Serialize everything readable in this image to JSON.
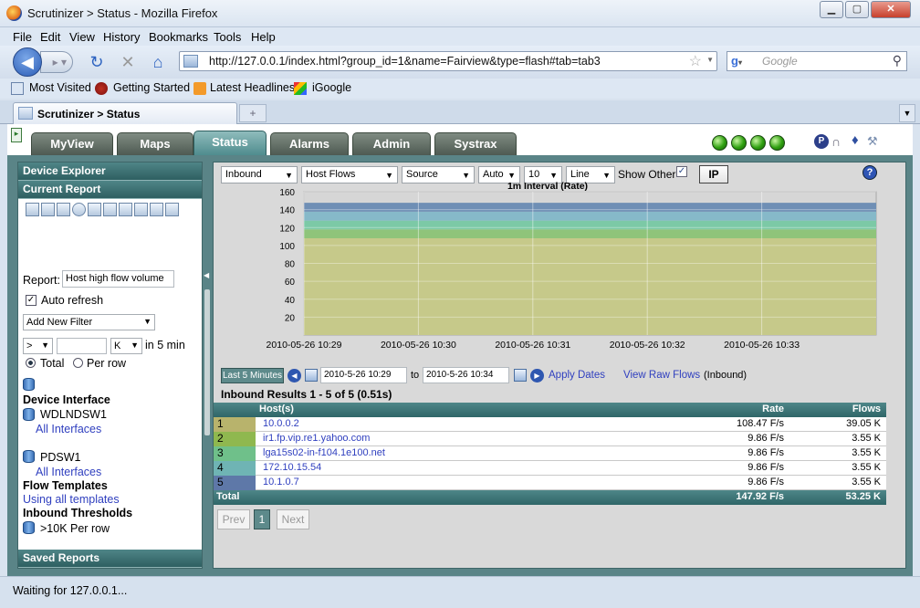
{
  "window": {
    "title": "Scrutinizer > Status - Mozilla Firefox"
  },
  "menubar": [
    "File",
    "Edit",
    "View",
    "History",
    "Bookmarks",
    "Tools",
    "Help"
  ],
  "navbar": {
    "url": "http://127.0.0.1/index.html?group_id=1&name=Fairview&type=flash#tab=tab3",
    "search_placeholder": "Google"
  },
  "bookmarks": [
    "Most Visited",
    "Getting Started",
    "Latest Headlines",
    "iGoogle"
  ],
  "browser_tab": {
    "title": "Scrutinizer > Status"
  },
  "app_tabs": [
    "MyView",
    "Maps",
    "Status",
    "Alarms",
    "Admin",
    "Systrax"
  ],
  "left": {
    "device_explorer": "Device Explorer",
    "current_report": "Current Report",
    "report_label": "Report:",
    "report_value": "Host high flow volume",
    "auto_refresh": "Auto refresh",
    "add_filter": "Add New Filter",
    "op": ">",
    "unit": "K",
    "in_min": "in 5 min",
    "total": "Total",
    "per_row": "Per row",
    "device_interface_h": "Device Interface",
    "dev1": "WDLNDSW1",
    "dev1_link": "All Interfaces",
    "dev2": "PDSW1",
    "dev2_link": "All Interfaces",
    "flow_templates_h": "Flow Templates",
    "flow_templates_link": "Using all templates",
    "thresholds_h": "Inbound Thresholds",
    "threshold_val": ">10K Per row",
    "saved_reports": "Saved Reports"
  },
  "controls": {
    "direction": "Inbound",
    "report_type": "Host Flows",
    "field": "Source",
    "scale": "Auto",
    "count": "10",
    "graph": "Line",
    "show_other": "Show Other",
    "ip": "IP",
    "help": "?"
  },
  "chart_data": {
    "type": "area",
    "title": "1m Interval (Rate)",
    "x": [
      "2010-05-26 10:29",
      "2010-05-26 10:30",
      "2010-05-26 10:31",
      "2010-05-26 10:32",
      "2010-05-26 10:33"
    ],
    "ylim": [
      0,
      160
    ],
    "yticks": [
      20,
      40,
      60,
      80,
      100,
      120,
      140,
      160
    ],
    "series": [
      {
        "values": [
          108,
          108,
          108,
          108,
          108,
          108
        ],
        "color": "#c6c98a"
      },
      {
        "values": [
          9.9,
          9.9,
          9.9,
          9.9,
          9.9,
          9.9
        ],
        "color": "#8fc47a"
      },
      {
        "values": [
          9.9,
          9.9,
          9.9,
          9.9,
          9.9,
          9.9
        ],
        "color": "#7cc9a6"
      },
      {
        "values": [
          9.9,
          9.9,
          9.9,
          9.9,
          9.9,
          9.9
        ],
        "color": "#86b9c9"
      },
      {
        "values": [
          9.9,
          9.9,
          9.9,
          9.9,
          9.9,
          9.9
        ],
        "color": "#6f8fb5"
      }
    ],
    "grid": true
  },
  "timebar": {
    "last_btn": "Last 5 Minutes",
    "from": "2010-5-26 10:29",
    "to_label": "to",
    "to": "2010-5-26 10:34",
    "apply": "Apply Dates",
    "raw": "View Raw Flows",
    "raw_suffix": "(Inbound)"
  },
  "results": {
    "summary": "Inbound Results 1 - 5 of 5 (0.51s)",
    "headers": {
      "host": "Host(s)",
      "rate": "Rate",
      "flows": "Flows"
    },
    "rows": [
      {
        "num": "1",
        "host": "10.0.0.2",
        "rate": "108.47 F/s",
        "flows": "39.05 K",
        "color": "#b8b36c"
      },
      {
        "num": "2",
        "host": "ir1.fp.vip.re1.yahoo.com",
        "rate": "9.86 F/s",
        "flows": "3.55 K",
        "color": "#8fb84f"
      },
      {
        "num": "3",
        "host": "lga15s02-in-f104.1e100.net",
        "rate": "9.86 F/s",
        "flows": "3.55 K",
        "color": "#6fc08a"
      },
      {
        "num": "4",
        "host": "172.10.15.54",
        "rate": "9.86 F/s",
        "flows": "3.55 K",
        "color": "#6fb4b4"
      },
      {
        "num": "5",
        "host": "10.1.0.7",
        "rate": "9.86 F/s",
        "flows": "3.55 K",
        "color": "#5e78a8"
      }
    ],
    "total_label": "Total",
    "total_rate": "147.92 F/s",
    "total_flows": "53.25 K"
  },
  "pager": {
    "prev": "Prev",
    "page": "1",
    "next": "Next"
  },
  "status": "Waiting for 127.0.0.1..."
}
